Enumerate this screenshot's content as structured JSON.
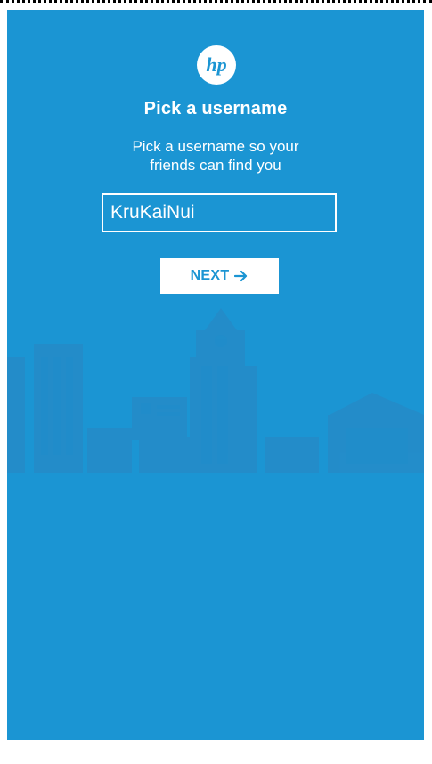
{
  "app": {
    "brand": "hp",
    "accent_color": "#1b95d3"
  },
  "header": {
    "title": "Pick a username",
    "subtitle_line1": "Pick a username so your",
    "subtitle_line2": "friends can find you"
  },
  "form": {
    "username_value": "KruKaiNui",
    "next_label": "NEXT",
    "next_icon": "arrow-right-icon"
  },
  "background": {
    "illustration": "city-skyline"
  }
}
